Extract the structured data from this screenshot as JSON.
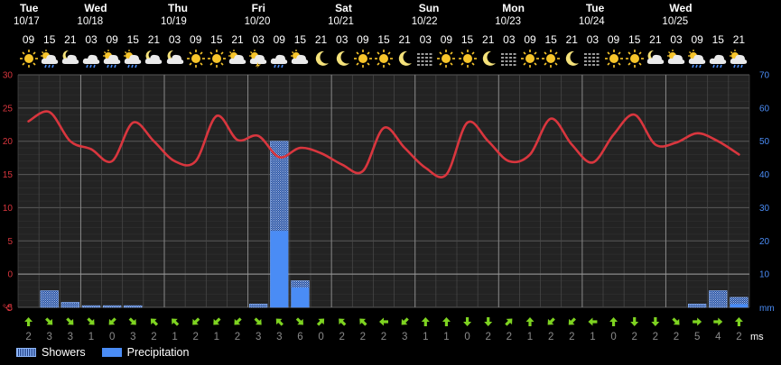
{
  "days": [
    {
      "name": "Tue",
      "date": "10/17"
    },
    {
      "name": "Wed",
      "date": "10/18"
    },
    {
      "name": "Thu",
      "date": "10/19"
    },
    {
      "name": "Fri",
      "date": "10/20"
    },
    {
      "name": "Sat",
      "date": "10/21"
    },
    {
      "name": "Sun",
      "date": "10/22"
    },
    {
      "name": "Mon",
      "date": "10/23"
    },
    {
      "name": "Tue",
      "date": "10/24"
    },
    {
      "name": "Wed",
      "date": "10/25"
    }
  ],
  "hours": [
    "09",
    "15",
    "21",
    "03",
    "09",
    "15",
    "21",
    "03",
    "09",
    "15",
    "21",
    "03",
    "09",
    "15",
    "21",
    "03",
    "09",
    "15",
    "21",
    "03",
    "09",
    "15",
    "21",
    "03",
    "09",
    "15",
    "21",
    "03",
    "09",
    "15",
    "21",
    "03",
    "09",
    "15",
    "21"
  ],
  "icons": [
    "sun",
    "sun-cloud-rain",
    "moon-cloud",
    "cloud-sun-rain",
    "sun-cloud-rain",
    "sun-cloud-rain",
    "moon-cloud",
    "moon-cloud",
    "sun",
    "sun",
    "sun-cloud",
    "sun-cloud-thunder",
    "cloud-rain",
    "sun-cloud",
    "moon",
    "moon",
    "sun",
    "sun",
    "moon",
    "fog",
    "sun",
    "sun",
    "moon",
    "fog",
    "sun",
    "sun",
    "moon",
    "fog",
    "sun",
    "sun",
    "moon-cloud",
    "sun-cloud",
    "sun-cloud-rain",
    "cloud-rain",
    "sun-cloud-rain"
  ],
  "legend": {
    "showers": "Showers",
    "precipitation": "Precipitation"
  },
  "colors": {
    "temperature": "#d9363e",
    "precipitation": "#4a8cf5",
    "showers": "#8fb8ff",
    "left_axis": "#d9363e",
    "right_axis": "#4a8cf5",
    "wind_arrow": "#7ed321"
  },
  "chart_data": {
    "type": "line",
    "x": [
      "10/17 09",
      "10/17 15",
      "10/17 21",
      "10/18 03",
      "10/18 09",
      "10/18 15",
      "10/18 21",
      "10/19 03",
      "10/19 09",
      "10/19 15",
      "10/19 21",
      "10/20 03",
      "10/20 09",
      "10/20 15",
      "10/20 21",
      "10/21 03",
      "10/21 09",
      "10/21 15",
      "10/21 21",
      "10/22 03",
      "10/22 09",
      "10/22 15",
      "10/22 21",
      "10/23 03",
      "10/23 09",
      "10/23 15",
      "10/23 21",
      "10/24 03",
      "10/24 09",
      "10/24 15",
      "10/24 21",
      "10/25 03",
      "10/25 09",
      "10/25 15",
      "10/25 21"
    ],
    "left_axis": {
      "unit": "°C",
      "ylim": [
        -5,
        30
      ],
      "ticks": [
        "30",
        "25",
        "20",
        "15",
        "10",
        "5",
        "0",
        "-5"
      ],
      "bottom_label": "°C"
    },
    "right_axis": {
      "unit": "mm",
      "ylim": [
        0,
        70
      ],
      "ticks": [
        "70",
        "60",
        "50",
        "40",
        "30",
        "20",
        "10"
      ],
      "bottom_label": "mm"
    },
    "series": [
      {
        "kind": "line",
        "values": [
          23,
          24.4,
          20,
          18.8,
          17,
          22.8,
          20,
          17,
          17,
          23.8,
          20.2,
          20.8,
          17.6,
          19,
          18.2,
          16.5,
          15.5,
          22,
          19,
          16,
          15,
          22.8,
          20,
          17,
          18,
          23.4,
          19.5,
          16.8,
          21,
          24,
          19.5,
          19.8,
          21.2,
          20,
          18
        ]
      },
      {
        "name": "Showers",
        "kind": "bar",
        "values": [
          0,
          5,
          1.5,
          0.5,
          0.5,
          0.5,
          0,
          0,
          0,
          0,
          0,
          1,
          50,
          8,
          0,
          0,
          0,
          0,
          0,
          0,
          0,
          0,
          0,
          0,
          0,
          0,
          0,
          0,
          0,
          0,
          0,
          0,
          1,
          5,
          3
        ]
      },
      {
        "name": "Precipitation",
        "kind": "bar",
        "values": [
          0,
          0,
          0,
          0,
          0,
          0,
          0,
          0,
          0,
          0,
          0,
          0,
          23,
          6,
          0,
          0,
          0,
          0,
          0,
          0,
          0,
          0,
          0,
          0,
          0,
          0,
          0,
          0,
          0,
          0,
          0,
          0,
          0,
          0,
          1
        ]
      }
    ],
    "wind": {
      "unit": "ms",
      "speeds": [
        2,
        3,
        3,
        1,
        0,
        3,
        2,
        1,
        2,
        1,
        2,
        3,
        3,
        6,
        0,
        2,
        2,
        2,
        3,
        1,
        1,
        0,
        2,
        2,
        1,
        2,
        2,
        1,
        0,
        2,
        2,
        2,
        5,
        4,
        2
      ],
      "directions": [
        "n",
        "se",
        "se",
        "se",
        "sw",
        "se",
        "nw",
        "nw",
        "sw",
        "sw",
        "sw",
        "se",
        "nw",
        "se",
        "ne",
        "nw",
        "nw",
        "w",
        "sw",
        "n",
        "n",
        "s",
        "s",
        "ne",
        "n",
        "sw",
        "sw",
        "w",
        "n",
        "s",
        "s",
        "se",
        "e",
        "e",
        "n"
      ]
    }
  }
}
